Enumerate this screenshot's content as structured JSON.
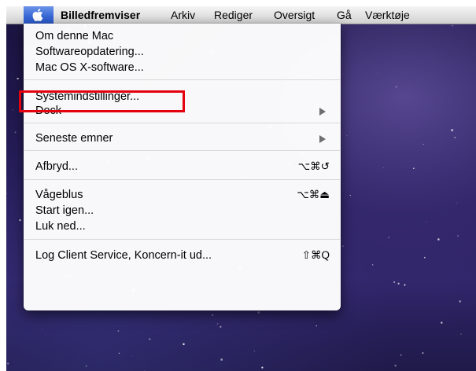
{
  "menubar": {
    "apple_icon": "apple-logo-icon",
    "items": [
      {
        "label": "Billedfremviser"
      },
      {
        "label": "Arkiv"
      },
      {
        "label": "Rediger"
      },
      {
        "label": "Oversigt"
      },
      {
        "label": "Gå"
      },
      {
        "label": "Værktøje"
      }
    ]
  },
  "apple_menu": {
    "groups": [
      [
        {
          "label": "Om denne Mac"
        },
        {
          "label": "Softwareopdatering..."
        },
        {
          "label": "Mac OS X-software..."
        }
      ],
      [
        {
          "label": "Systemindstillinger...",
          "highlighted": true
        },
        {
          "label": "Dock",
          "submenu": true,
          "arrow_icon": "submenu-arrow-icon"
        }
      ],
      [
        {
          "label": "Seneste emner",
          "submenu": true,
          "arrow_icon": "submenu-arrow-icon"
        }
      ],
      [
        {
          "label": "Afbryd...",
          "shortcut": "⌥⌘↺"
        }
      ],
      [
        {
          "label": "Vågeblus",
          "shortcut": "⌥⌘⏏"
        },
        {
          "label": "Start igen..."
        },
        {
          "label": "Luk ned..."
        }
      ],
      [
        {
          "label": "Log Client Service, Koncern-it ud...",
          "shortcut": "⇧⌘Q"
        }
      ]
    ]
  },
  "annotation": {
    "color": "#e4000f"
  },
  "colors": {
    "menubar_highlight": "#3767d6"
  }
}
